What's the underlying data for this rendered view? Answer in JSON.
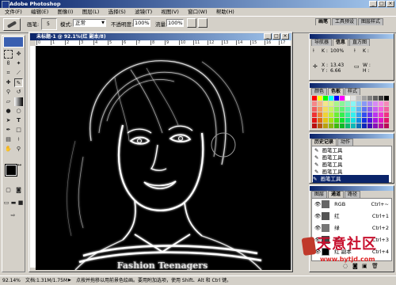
{
  "app": {
    "title": "Adobe Photoshop"
  },
  "menu": [
    "文件(F)",
    "编辑(E)",
    "图像(I)",
    "图层(L)",
    "选择(S)",
    "滤镜(T)",
    "视图(V)",
    "窗口(W)",
    "帮助(H)"
  ],
  "options": {
    "brush_label": "画笔:",
    "brush_size": "5",
    "mode_label": "模式:",
    "mode_value": "正常",
    "opacity_label": "不透明度:",
    "opacity_value": "100%",
    "flow_label": "流量:",
    "flow_value": "100%",
    "wet_edges": "湿边",
    "tabs": [
      "画笔",
      "工具预设",
      "图层样式"
    ]
  },
  "document": {
    "title": "未标题-1 @ 92.1%(红 副本/8)"
  },
  "ruler_ticks": [
    "0",
    "1",
    "2",
    "3",
    "4",
    "5",
    "6",
    "7",
    "8",
    "9",
    "10",
    "11",
    "12",
    "13",
    "14",
    "15",
    "16",
    "17"
  ],
  "status": {
    "zoom": "92.14%",
    "doc": "文档:1.31M/1.75M",
    "hint": "点按并拖移以用前景色绘画。要用附加选项，使用 Shift、Alt 和 Ctrl 键。"
  },
  "navigator": {
    "tabs": [
      "导航器",
      "信息",
      "直方图"
    ],
    "k_label": "K :",
    "k_value": "100%",
    "k2_label": "K :",
    "x_label": "X :",
    "x_value": "13.43",
    "y_label": "Y :",
    "y_value": "6.66",
    "w_label": "W :",
    "h_label": "H :"
  },
  "swatches_panel": {
    "tabs": [
      "颜色",
      "色板",
      "样式"
    ]
  },
  "history": {
    "tabs": [
      "历史记录",
      "动作"
    ],
    "items": [
      "画笔工具",
      "画笔工具",
      "画笔工具",
      "画笔工具",
      "画笔工具"
    ]
  },
  "channels": {
    "tabs": [
      "图层",
      "通道",
      "路径"
    ],
    "items": [
      {
        "name": "RGB",
        "shortcut": "Ctrl+~"
      },
      {
        "name": "红",
        "shortcut": "Ctrl+1"
      },
      {
        "name": "绿",
        "shortcut": "Ctrl+2"
      },
      {
        "name": "蓝",
        "shortcut": "Ctrl+3"
      },
      {
        "name": "红 副本",
        "shortcut": "Ctrl+4"
      }
    ]
  },
  "watermark": {
    "text": "天意社区",
    "url": "www.bytjd.com"
  },
  "canvas_text": "Fashion Teenagers"
}
